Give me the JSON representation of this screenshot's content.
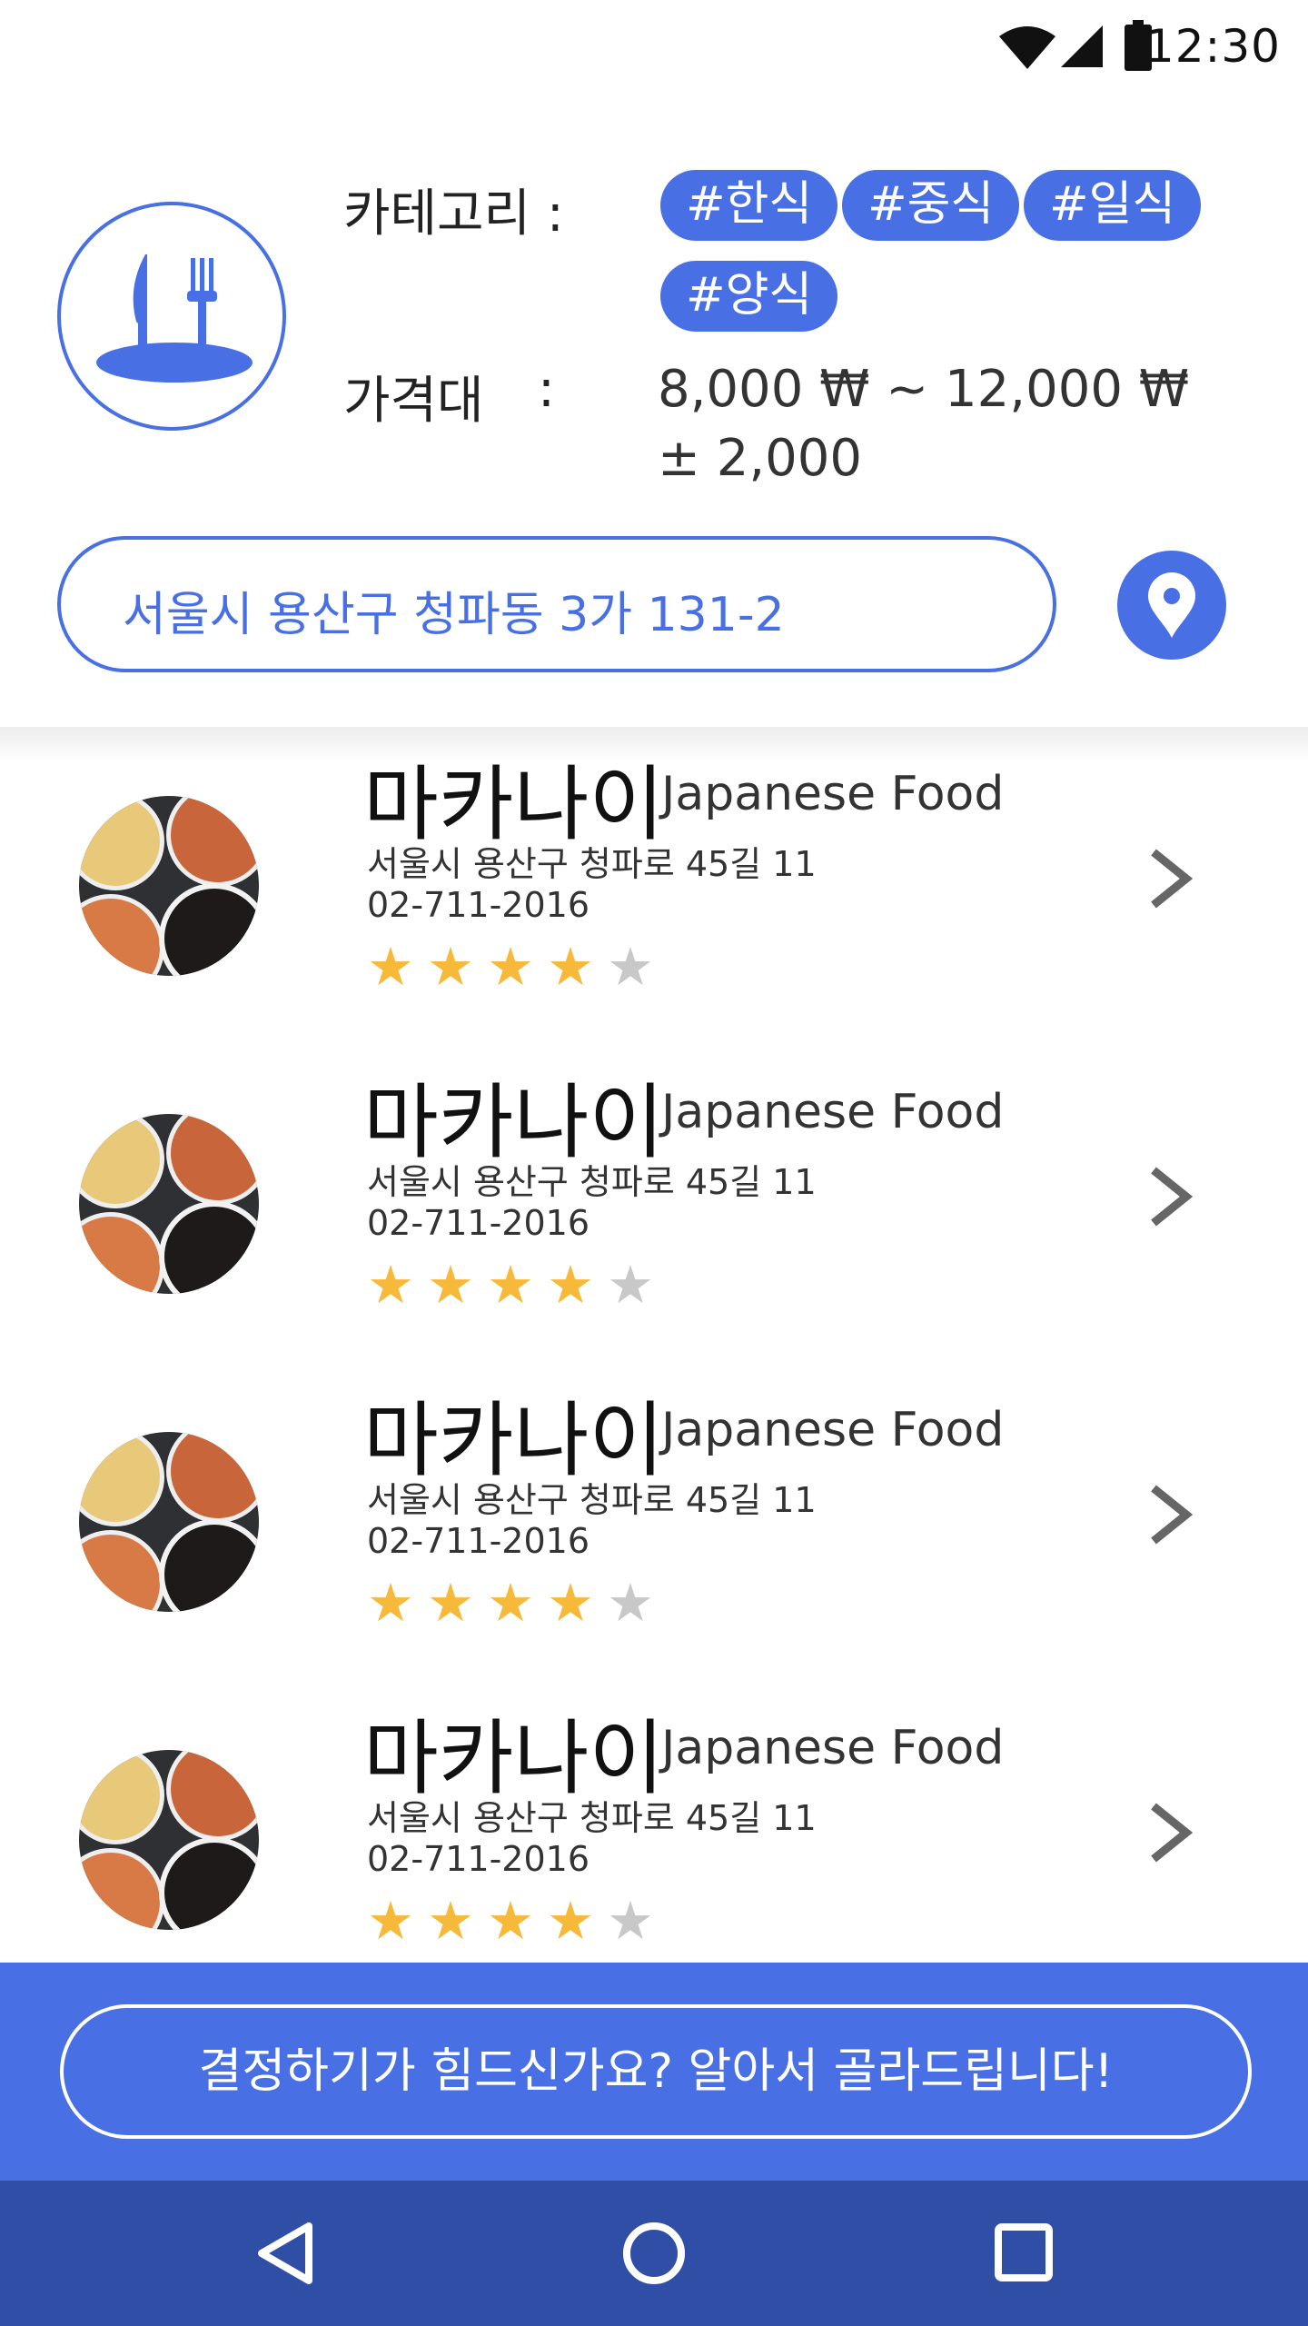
{
  "status_bar": {
    "time": "12:30"
  },
  "header": {
    "category_label": "카테고리 :",
    "tags": [
      "#한식",
      "#중식",
      "#일식",
      "#양식"
    ],
    "price_label": "가격대",
    "price_colon": ":",
    "price_range": "8,000 ₩ ~ 12,000 ₩",
    "price_tolerance": "± 2,000",
    "address": "서울시 용산구 청파동 3가 131-2"
  },
  "restaurants": [
    {
      "name": "마카나이",
      "cuisine": "Japanese Food",
      "address": "서울시 용산구 청파로 45길 11",
      "phone": "02-711-2016",
      "rating": 4,
      "max_rating": 5
    },
    {
      "name": "마카나이",
      "cuisine": "Japanese Food",
      "address": "서울시 용산구 청파로 45길 11",
      "phone": "02-711-2016",
      "rating": 4,
      "max_rating": 5
    },
    {
      "name": "마카나이",
      "cuisine": "Japanese Food",
      "address": "서울시 용산구 청파로 45길 11",
      "phone": "02-711-2016",
      "rating": 4,
      "max_rating": 5
    },
    {
      "name": "마카나이",
      "cuisine": "Japanese Food",
      "address": "서울시 용산구 청파로 45길 11",
      "phone": "02-711-2016",
      "rating": 4,
      "max_rating": 5
    }
  ],
  "cta": {
    "label": "결정하기가 힘드신가요? 알아서 골라드립니다!"
  },
  "icons": {
    "logo": "fork-knife-plate-icon",
    "location": "map-pin-icon",
    "chevron": "chevron-right-icon",
    "star": "star-icon",
    "nav_back": "back-triangle-icon",
    "nav_home": "home-circle-icon",
    "nav_recents": "recents-square-icon"
  },
  "colors": {
    "accent": "#4870e4",
    "nav": "#2f4ea6",
    "star_on": "#f6b93a",
    "star_off": "#c8c8c8"
  }
}
